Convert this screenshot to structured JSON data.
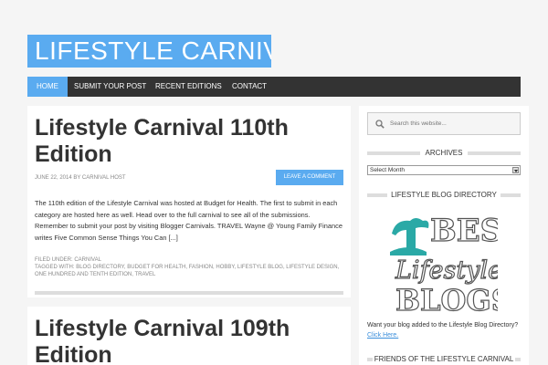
{
  "site": {
    "title": "LIFESTYLE CARNIVAL"
  },
  "nav": {
    "items": [
      {
        "label": "HOME",
        "active": true
      },
      {
        "label": "SUBMIT YOUR POST"
      },
      {
        "label": "RECENT EDITIONS"
      },
      {
        "label": "CONTACT"
      }
    ]
  },
  "posts": [
    {
      "title": "Lifestyle Carnival 110th Edition",
      "meta": "JUNE 22, 2014 BY CARNIVAL HOST",
      "comment_button": "LEAVE A COMMENT",
      "excerpt": "The 110th edition of the Lifestyle Carnival was hosted at Budget for Health. The first to submit in each category are hosted here as well. Head over to the full carnival to see all of the submissions. Remember to submit your post by visiting Blogger Carnivals. TRAVEL Wayne @ Young Family Finance writes Five Common Sense Things You Can [...]",
      "filed_under": "FILED UNDER: CARNIVAL",
      "tagged_with": "TAGGED WITH: BLOG DIRECTORY, BUDGET FOR HEALTH, FASHION, HOBBY, LIFESTYLE BLOG, LIFESTYLE DESIGN, ONE HUNDRED AND TENTH EDITION, TRAVEL"
    },
    {
      "title": "Lifestyle Carnival 109th Edition"
    }
  ],
  "sidebar": {
    "search_placeholder": "Search this website...",
    "archives_title": "ARCHIVES",
    "archives_select": "Select Month",
    "directory_title": "LIFESTYLE BLOG DIRECTORY",
    "badge": {
      "line1": "BEST",
      "line2": "Lifestyle",
      "line3": "BLOGS"
    },
    "blurb_text": "Want your blog added to the Lifestyle Blog Directory?",
    "blurb_link": "Click Here.",
    "friends_title": "FRIENDS OF THE LIFESTYLE CARNIVAL"
  },
  "colors": {
    "accent": "#5aabf0",
    "nav_bg": "#333333",
    "teal": "#2aa9a6"
  }
}
